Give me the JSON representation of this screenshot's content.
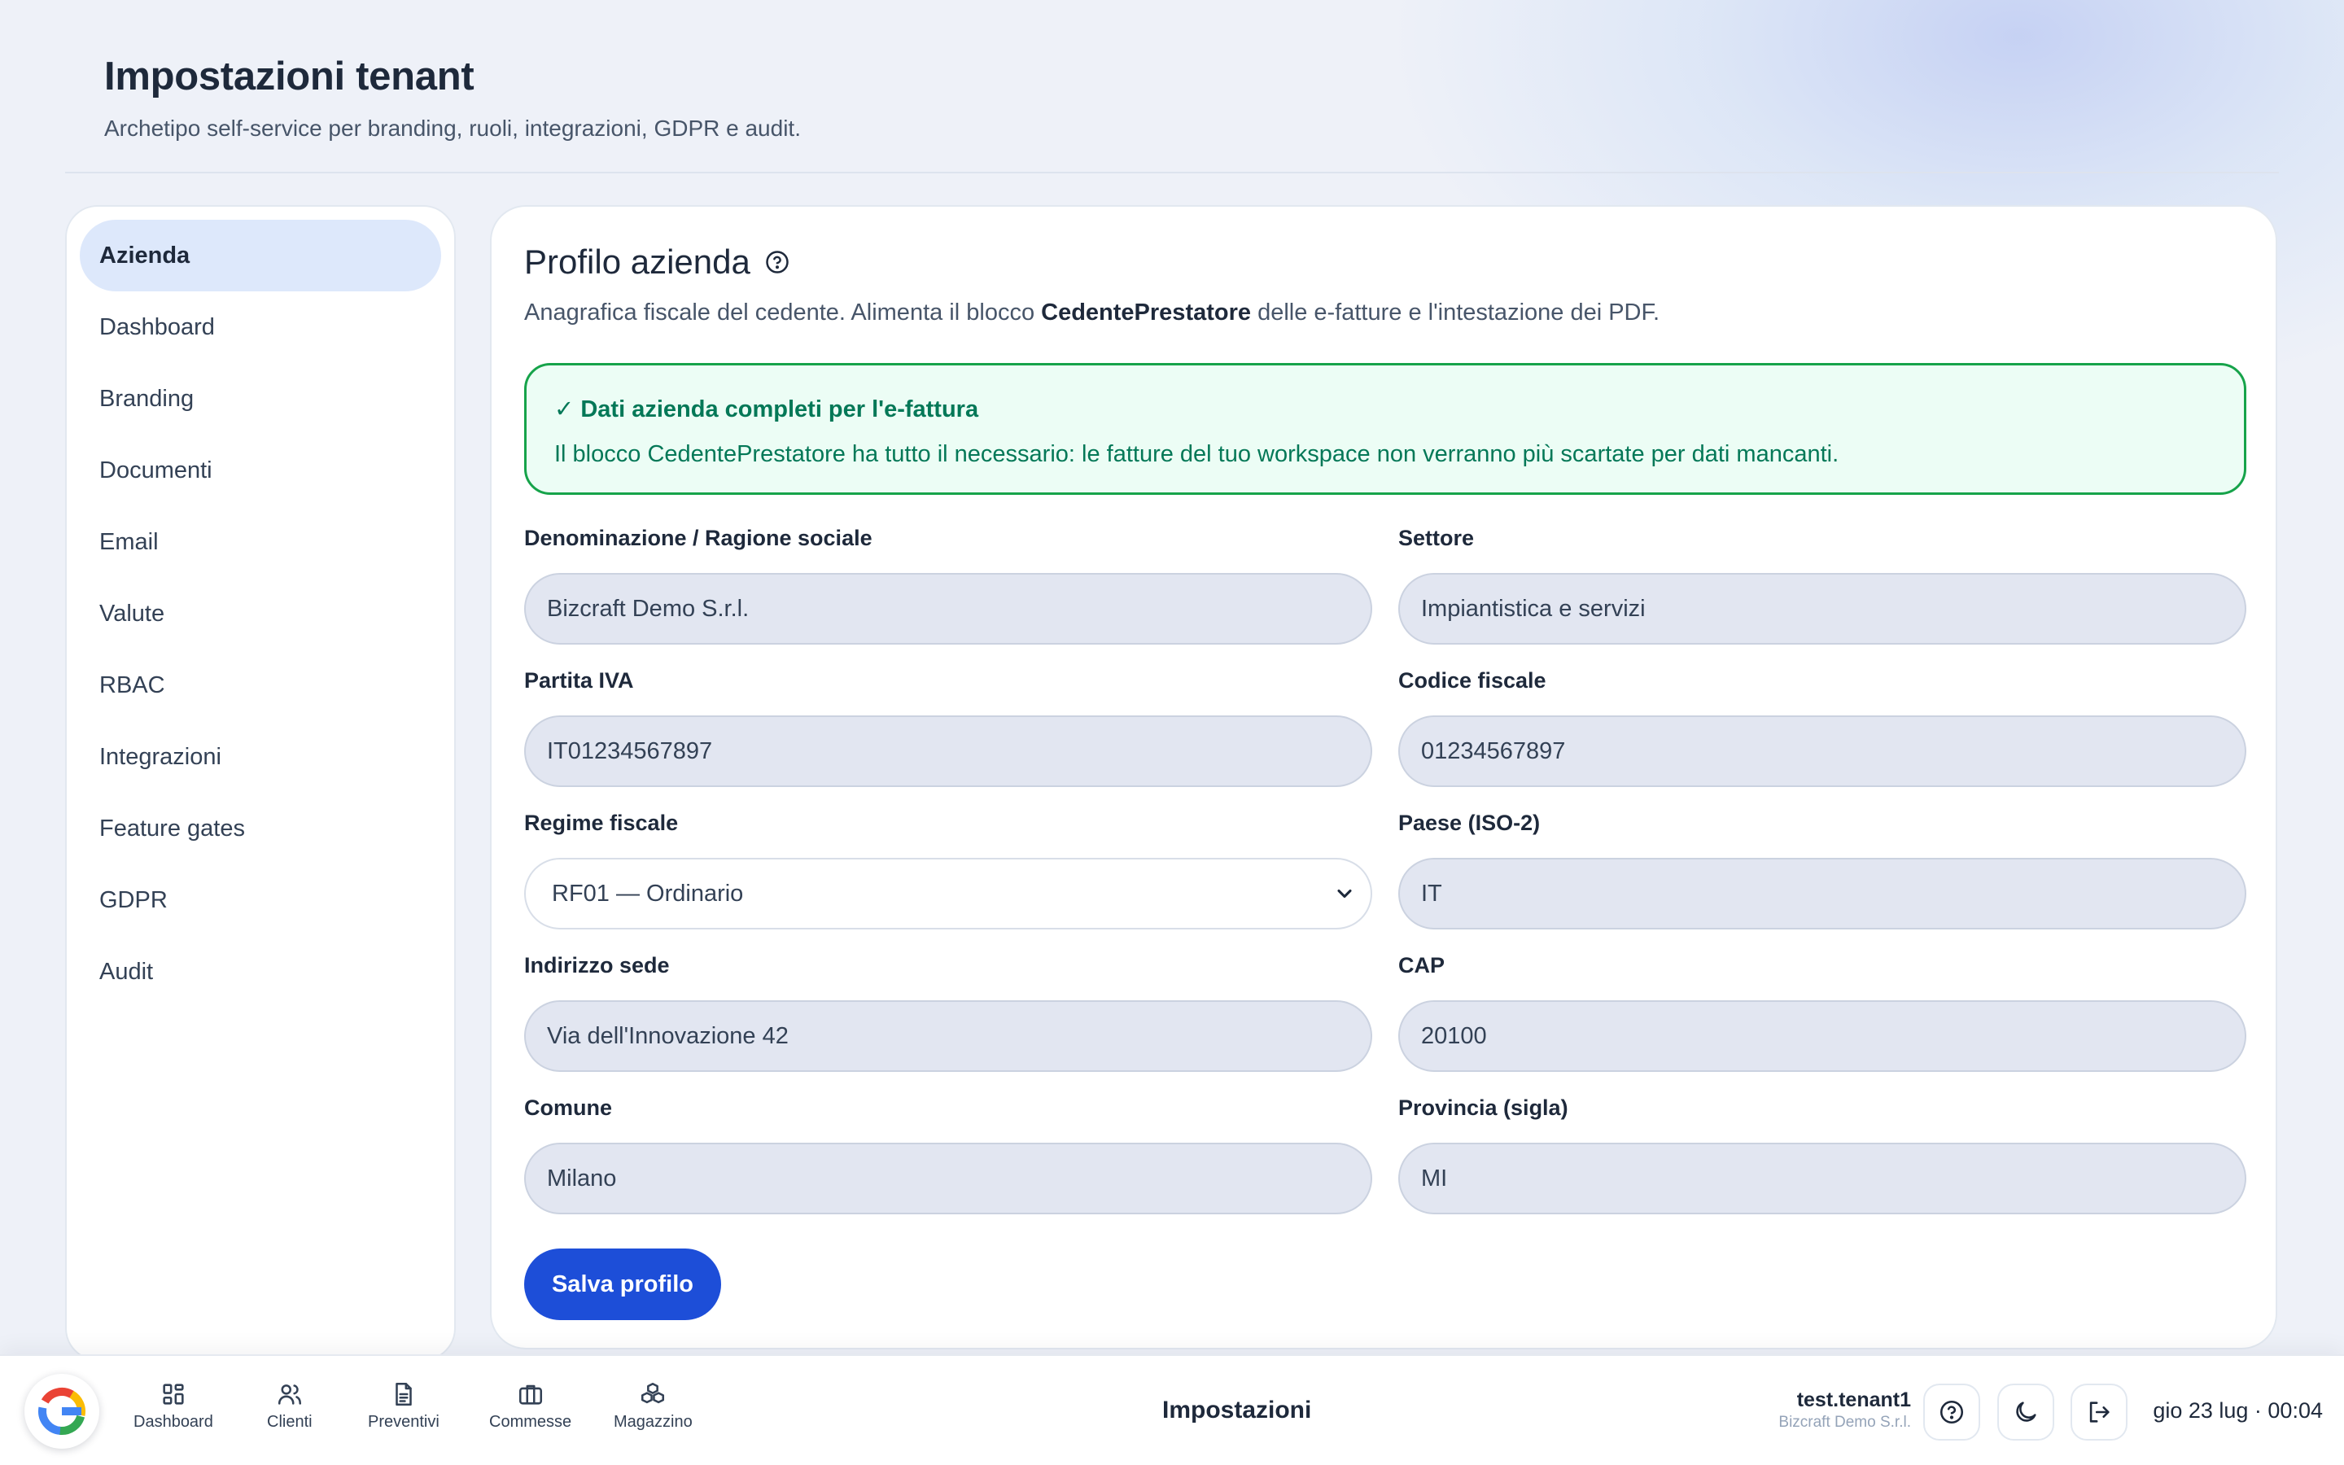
{
  "header": {
    "title": "Impostazioni tenant",
    "subtitle": "Archetipo self-service per branding, ruoli, integrazioni, GDPR e audit."
  },
  "sidebar": {
    "items": [
      {
        "label": "Azienda",
        "active": true
      },
      {
        "label": "Dashboard"
      },
      {
        "label": "Branding"
      },
      {
        "label": "Documenti"
      },
      {
        "label": "Email"
      },
      {
        "label": "Valute"
      },
      {
        "label": "RBAC"
      },
      {
        "label": "Integrazioni"
      },
      {
        "label": "Feature gates"
      },
      {
        "label": "GDPR"
      },
      {
        "label": "Audit"
      }
    ]
  },
  "panel": {
    "title": "Profilo azienda",
    "desc_before": "Anagrafica fiscale del cedente. Alimenta il blocco ",
    "desc_bold": "CedentePrestatore",
    "desc_after": " delle e-fatture e l'intestazione dei PDF.",
    "alert": {
      "title": "✓ Dati azienda completi per l'e-fattura",
      "text": "Il blocco CedentePrestatore ha tutto il necessario: le fatture del tuo workspace non verranno più scartate per dati mancanti."
    },
    "fields": {
      "denominazione": {
        "label": "Denominazione / Ragione sociale",
        "value": "Bizcraft Demo S.r.l."
      },
      "settore": {
        "label": "Settore",
        "value": "Impiantistica e servizi"
      },
      "partita_iva": {
        "label": "Partita IVA",
        "value": "IT01234567897"
      },
      "codice_fiscale": {
        "label": "Codice fiscale",
        "value": "01234567897"
      },
      "regime_fiscale": {
        "label": "Regime fiscale",
        "value": "RF01 — Ordinario"
      },
      "paese": {
        "label": "Paese (ISO-2)",
        "value": "IT"
      },
      "indirizzo": {
        "label": "Indirizzo sede",
        "value": "Via dell'Innovazione 42"
      },
      "cap": {
        "label": "CAP",
        "value": "20100"
      },
      "comune": {
        "label": "Comune",
        "value": "Milano"
      },
      "provincia": {
        "label": "Provincia (sigla)",
        "value": "MI"
      }
    },
    "save_label": "Salva profilo"
  },
  "bottom_bar": {
    "nav": [
      {
        "label": "Dashboard",
        "icon": "grid-icon"
      },
      {
        "label": "Clienti",
        "icon": "users-icon"
      },
      {
        "label": "Preventivi",
        "icon": "document-icon"
      },
      {
        "label": "Commesse",
        "icon": "briefcase-icon"
      },
      {
        "label": "Magazzino",
        "icon": "boxes-icon"
      }
    ],
    "title": "Impostazioni",
    "user_name": "test.tenant1",
    "user_company": "Bizcraft Demo S.r.l.",
    "datetime": "gio 23 lug · 00:04"
  },
  "colors": {
    "accent": "#1d4ed8",
    "success": "#047857",
    "active_nav": "#dde8fb"
  }
}
